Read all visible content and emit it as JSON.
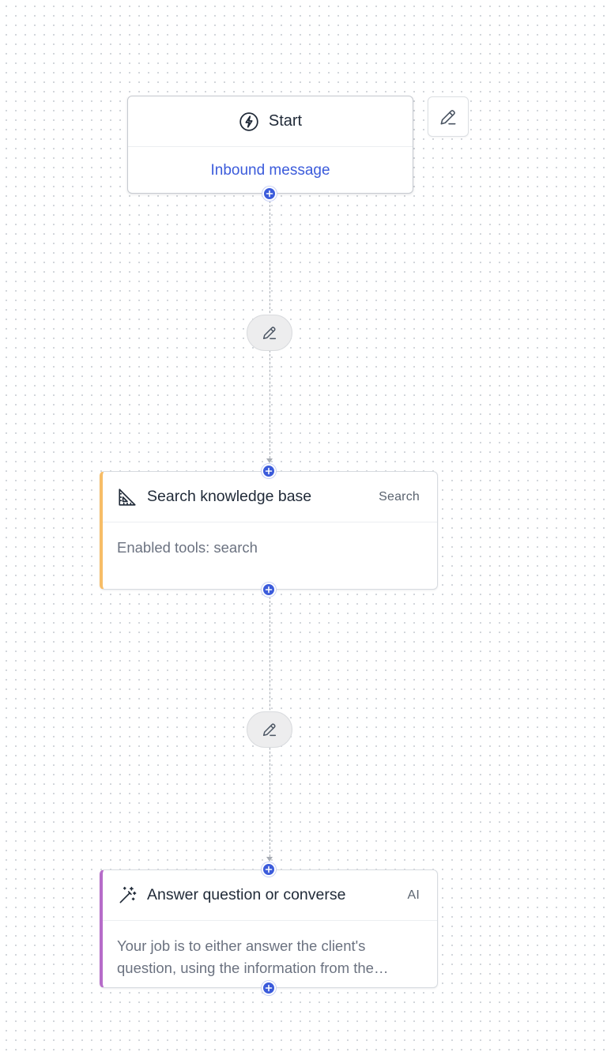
{
  "flow": {
    "trigger": {
      "title": "Start",
      "icon": "lightning-bolt-icon",
      "event": "Inbound message"
    },
    "steps": [
      {
        "title": "Search knowledge base",
        "tag": "Search",
        "icon": "triangle-ruler-icon",
        "accent_color": "#f7bd67",
        "description": "Enabled tools: search"
      },
      {
        "title": "Answer question or converse",
        "tag": "AI",
        "icon": "magic-wand-icon",
        "accent_color": "#b66cc9",
        "description": "Your job is to either answer the client's question, using the information from the knowledge base, or converse with them naturally."
      }
    ]
  },
  "colors": {
    "handle": "#3b5bdb",
    "link": "#3b5bdb",
    "edge": "#a8adb5"
  }
}
